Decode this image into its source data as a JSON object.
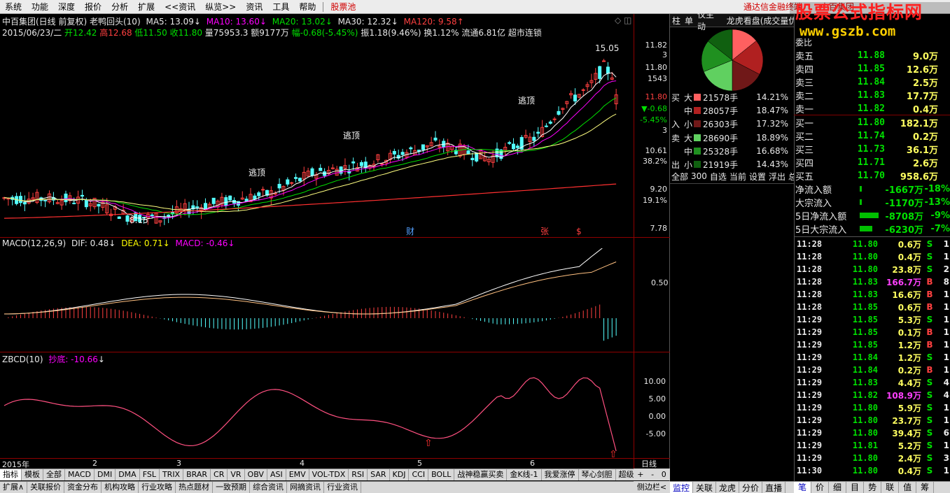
{
  "menu": [
    "系统",
    "功能",
    "深度",
    "报价",
    "分析",
    "扩展",
    "<<资讯",
    "纵览>>",
    "资讯",
    "工具",
    "帮助"
  ],
  "menu_stock_pool": "股票池",
  "menu_right": [
    "通达信金融终端",
    "中百集团"
  ],
  "watermark": {
    "line1": "股票公式指标网",
    "line2": "www.gszb.com"
  },
  "header": {
    "title": "中百集团(日线 前复权) 老鸭回头(10)",
    "ma5": "MA5: 13.09",
    "ma10": "MA10: 13.60",
    "ma20": "MA20: 13.02",
    "ma30": "MA30: 12.32",
    "ma120": "MA120: 9.58",
    "date": "2015/06/23/二",
    "open": "开12.42",
    "high": "高12.68",
    "low": "低11.50",
    "close": "收11.80",
    "vol": "量75953.3",
    "amount": "额9177万",
    "change": "幅-0.68(-5.45%)",
    "amplitude": "振1.18(9.46%)",
    "turnover": "换1.12%",
    "float": "流通6.81亿",
    "concept": "超市连锁"
  },
  "main_axis": [
    "11.82",
    "3",
    "11.80",
    "1543",
    "11.80",
    "▼-0.68",
    "-5.45%",
    "3",
    "10.61",
    "38.2%",
    "9.20",
    "19.1%",
    "7.78"
  ],
  "main_labels": {
    "high": "15.05",
    "low": "8.15",
    "top1": "逃顶",
    "top2": "逃顶",
    "top3": "逃顶",
    "cai": "财",
    "zhang": "张",
    "dollar": "$"
  },
  "macd": {
    "title": "MACD(12,26,9)",
    "dif": "DIF: 0.48",
    "dea": "DEA: 0.71",
    "macd": "MACD: -0.46",
    "axis": "0.50"
  },
  "zbcd": {
    "title": "ZBCD(10)",
    "value": "抄底: -10.66",
    "axis": [
      "10.00",
      "5.00",
      "0.00",
      "-5.00"
    ]
  },
  "date_axis": [
    "2015年",
    "2",
    "3",
    "4",
    "5",
    "6"
  ],
  "period": "日线",
  "tabs1": [
    "指标",
    "模板",
    "全部",
    "MACD",
    "DMI",
    "DMA",
    "FSL",
    "TRIX",
    "BRAR",
    "CR",
    "VR",
    "OBV",
    "ASI",
    "EMV",
    "VOL-TDX",
    "RSI",
    "SAR",
    "KDJ",
    "CCI",
    "BOLL",
    "战神稳赢买卖",
    "金K线-1",
    "我爱涨停",
    "琴心剑胆",
    "超级指标"
  ],
  "tabs1_more": ">",
  "tabs1_ctrl": [
    "+",
    "-",
    "0"
  ],
  "tabs2": [
    "扩展∧",
    "关联报价",
    "资金分布",
    "机构攻略",
    "行业攻略",
    "热点题材",
    "一致预期",
    "综合资讯",
    "网摘资讯",
    "行业资讯"
  ],
  "side_toggle": "侧边栏<",
  "right_tabs_top": [
    "柱",
    "单",
    "仅主动",
    "龙虎看盘(成交量优"
  ],
  "flow": {
    "buy_label": "买",
    "in_label": "入",
    "sell_label": "卖",
    "out_label": "出",
    "rows": [
      {
        "size": "大",
        "vol": "21578手",
        "pct": "14.21%",
        "color": "#ff6060"
      },
      {
        "size": "中",
        "vol": "28057手",
        "pct": "18.47%",
        "color": "#b02020"
      },
      {
        "size": "小",
        "vol": "26303手",
        "pct": "17.32%",
        "color": "#701818"
      },
      {
        "size": "大",
        "vol": "28690手",
        "pct": "18.89%",
        "color": "#60d060"
      },
      {
        "size": "中",
        "vol": "25328手",
        "pct": "16.68%",
        "color": "#209020"
      },
      {
        "size": "小",
        "vol": "21919手",
        "pct": "14.43%",
        "color": "#106010"
      }
    ],
    "bottom": [
      "全部",
      "300",
      "自选",
      "当前",
      "设置",
      "浮出",
      "总"
    ]
  },
  "orderbook_title": "委比",
  "orderbook": [
    {
      "label": "卖五",
      "price": "11.88",
      "vol": "9.0万"
    },
    {
      "label": "卖四",
      "price": "11.85",
      "vol": "12.6万"
    },
    {
      "label": "卖三",
      "price": "11.84",
      "vol": "2.5万"
    },
    {
      "label": "卖二",
      "price": "11.83",
      "vol": "17.7万"
    },
    {
      "label": "卖一",
      "price": "11.82",
      "vol": "0.4万"
    },
    {
      "label": "买一",
      "price": "11.80",
      "vol": "182.1万"
    },
    {
      "label": "买二",
      "price": "11.74",
      "vol": "0.2万"
    },
    {
      "label": "买三",
      "price": "11.73",
      "vol": "36.1万"
    },
    {
      "label": "买四",
      "price": "11.71",
      "vol": "2.6万"
    },
    {
      "label": "买五",
      "price": "11.70",
      "vol": "958.6万"
    }
  ],
  "netflow": [
    {
      "label": "净流入额",
      "bar": 0.05,
      "val": "-1667万",
      "pct": "-18%"
    },
    {
      "label": "大宗流入",
      "bar": 0.04,
      "val": "-1170万",
      "pct": "-13%"
    },
    {
      "label": "5日净流入额",
      "bar": 0.9,
      "val": "-8708万",
      "pct": "-9%"
    },
    {
      "label": "5日大宗流入",
      "bar": 0.6,
      "val": "-6230万",
      "pct": "-7%"
    }
  ],
  "trades": [
    {
      "t": "11:28",
      "p": "11.80",
      "v": "0.6万",
      "s": "S",
      "n": "1"
    },
    {
      "t": "11:28",
      "p": "11.80",
      "v": "0.4万",
      "s": "S",
      "n": "1"
    },
    {
      "t": "11:28",
      "p": "11.80",
      "v": "23.8万",
      "s": "S",
      "n": "2"
    },
    {
      "t": "11:28",
      "p": "11.83",
      "v": "166.7万",
      "s": "B",
      "n": "8"
    },
    {
      "t": "11:28",
      "p": "11.83",
      "v": "16.6万",
      "s": "B",
      "n": "1"
    },
    {
      "t": "11:28",
      "p": "11.85",
      "v": "0.6万",
      "s": "B",
      "n": "1"
    },
    {
      "t": "11:29",
      "p": "11.85",
      "v": "5.3万",
      "s": "S",
      "n": "1"
    },
    {
      "t": "11:29",
      "p": "11.85",
      "v": "0.1万",
      "s": "B",
      "n": "1"
    },
    {
      "t": "11:29",
      "p": "11.85",
      "v": "1.2万",
      "s": "B",
      "n": "1"
    },
    {
      "t": "11:29",
      "p": "11.84",
      "v": "1.2万",
      "s": "S",
      "n": "1"
    },
    {
      "t": "11:29",
      "p": "11.84",
      "v": "0.2万",
      "s": "B",
      "n": "1"
    },
    {
      "t": "11:29",
      "p": "11.83",
      "v": "4.4万",
      "s": "S",
      "n": "4"
    },
    {
      "t": "11:29",
      "p": "11.82",
      "v": "108.9万",
      "s": "S",
      "n": "4"
    },
    {
      "t": "11:29",
      "p": "11.80",
      "v": "5.9万",
      "s": "S",
      "n": "1"
    },
    {
      "t": "11:29",
      "p": "11.80",
      "v": "23.7万",
      "s": "S",
      "n": "1"
    },
    {
      "t": "11:29",
      "p": "11.80",
      "v": "39.4万",
      "s": "S",
      "n": "6"
    },
    {
      "t": "11:29",
      "p": "11.81",
      "v": "5.2万",
      "s": "S",
      "n": "1"
    },
    {
      "t": "11:29",
      "p": "11.80",
      "v": "2.4万",
      "s": "S",
      "n": "3"
    },
    {
      "t": "11:30",
      "p": "11.80",
      "v": "0.4万",
      "s": "S",
      "n": "1"
    }
  ],
  "right_bottom_tabs": [
    "笔",
    "价",
    "细",
    "目",
    "势",
    "联",
    "值",
    "筹"
  ],
  "mid_bottom_tabs": [
    "监控",
    "关联",
    "龙虎",
    "分价",
    "直播"
  ],
  "colors": {
    "up": "#ff4040",
    "down": "#00e000",
    "axis": "#900000",
    "bg": "#000000"
  }
}
